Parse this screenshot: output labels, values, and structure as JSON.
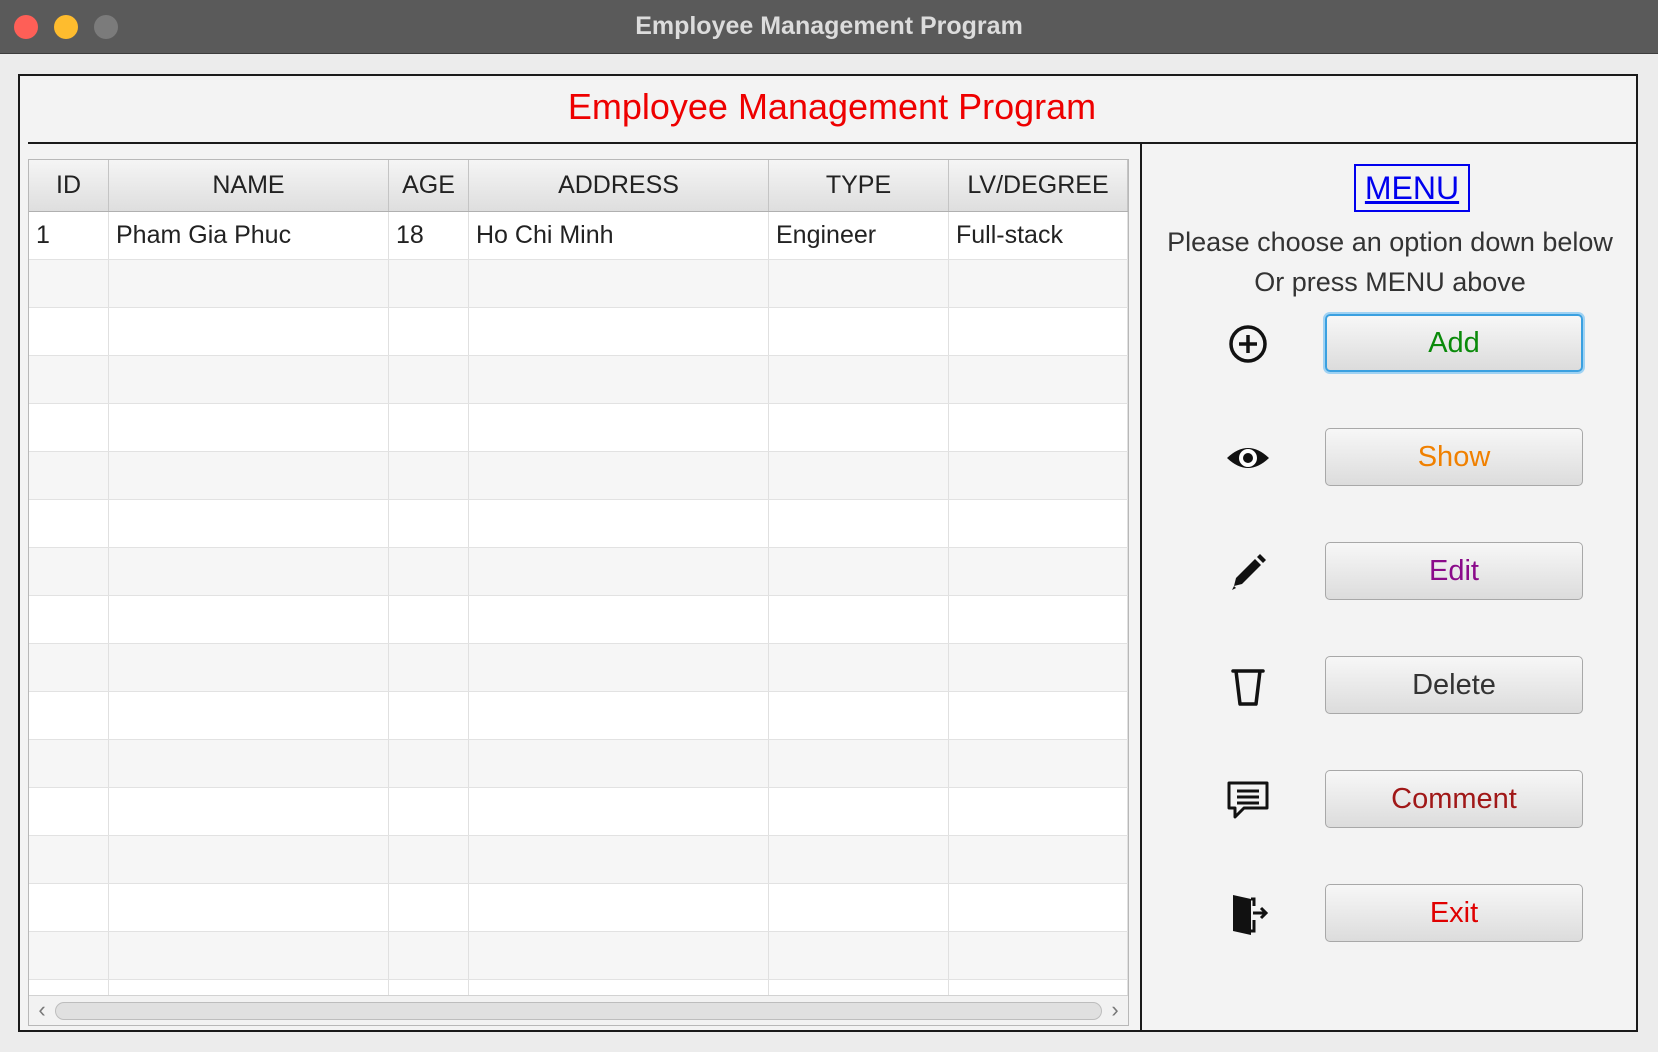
{
  "window": {
    "title": "Employee Management Program"
  },
  "header": {
    "title": "Employee Management Program"
  },
  "table": {
    "columns": [
      "ID",
      "NAME",
      "AGE",
      "ADDRESS",
      "TYPE",
      "LV/DEGREE"
    ],
    "rows": [
      [
        "1",
        "Pham Gia Phuc",
        "18",
        "Ho Chi Minh",
        "Engineer",
        "Full-stack"
      ]
    ]
  },
  "menu": {
    "link_label": "MENU",
    "line1": "Please choose an option down below",
    "line2": "Or press MENU above",
    "buttons": [
      {
        "label": "Add",
        "icon": "plus-circle-icon",
        "color": "#0a8a0a"
      },
      {
        "label": "Show",
        "icon": "eye-icon",
        "color": "#f08000"
      },
      {
        "label": "Edit",
        "icon": "pencil-icon",
        "color": "#8a0a8a"
      },
      {
        "label": "Delete",
        "icon": "trash-icon",
        "color": "#333333"
      },
      {
        "label": "Comment",
        "icon": "comment-icon",
        "color": "#a01818"
      },
      {
        "label": "Exit",
        "icon": "exit-door-icon",
        "color": "#e00000"
      }
    ]
  },
  "scrollbar": {
    "left_arrow": "‹",
    "right_arrow": "›"
  }
}
